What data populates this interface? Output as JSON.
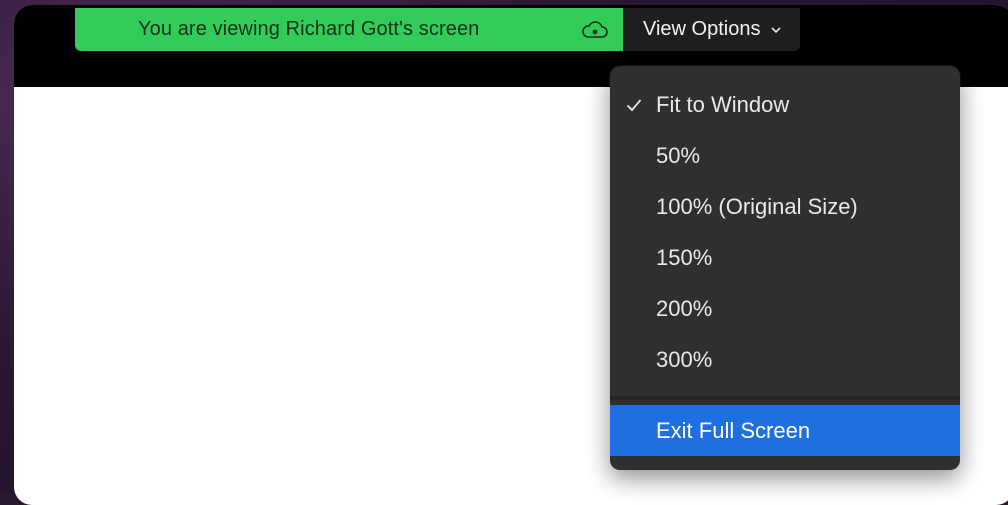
{
  "banner": {
    "text": "You are viewing Richard Gott's screen",
    "color": "#33cc5a"
  },
  "view_options": {
    "label": "View Options"
  },
  "menu": {
    "items": [
      {
        "label": "Fit to Window",
        "checked": true
      },
      {
        "label": "50%"
      },
      {
        "label": "100% (Original Size)"
      },
      {
        "label": "150%"
      },
      {
        "label": "200%"
      },
      {
        "label": "300%"
      },
      {
        "label": "Exit Full Screen",
        "highlighted": true
      }
    ],
    "highlight_color": "#1e6fe0"
  }
}
